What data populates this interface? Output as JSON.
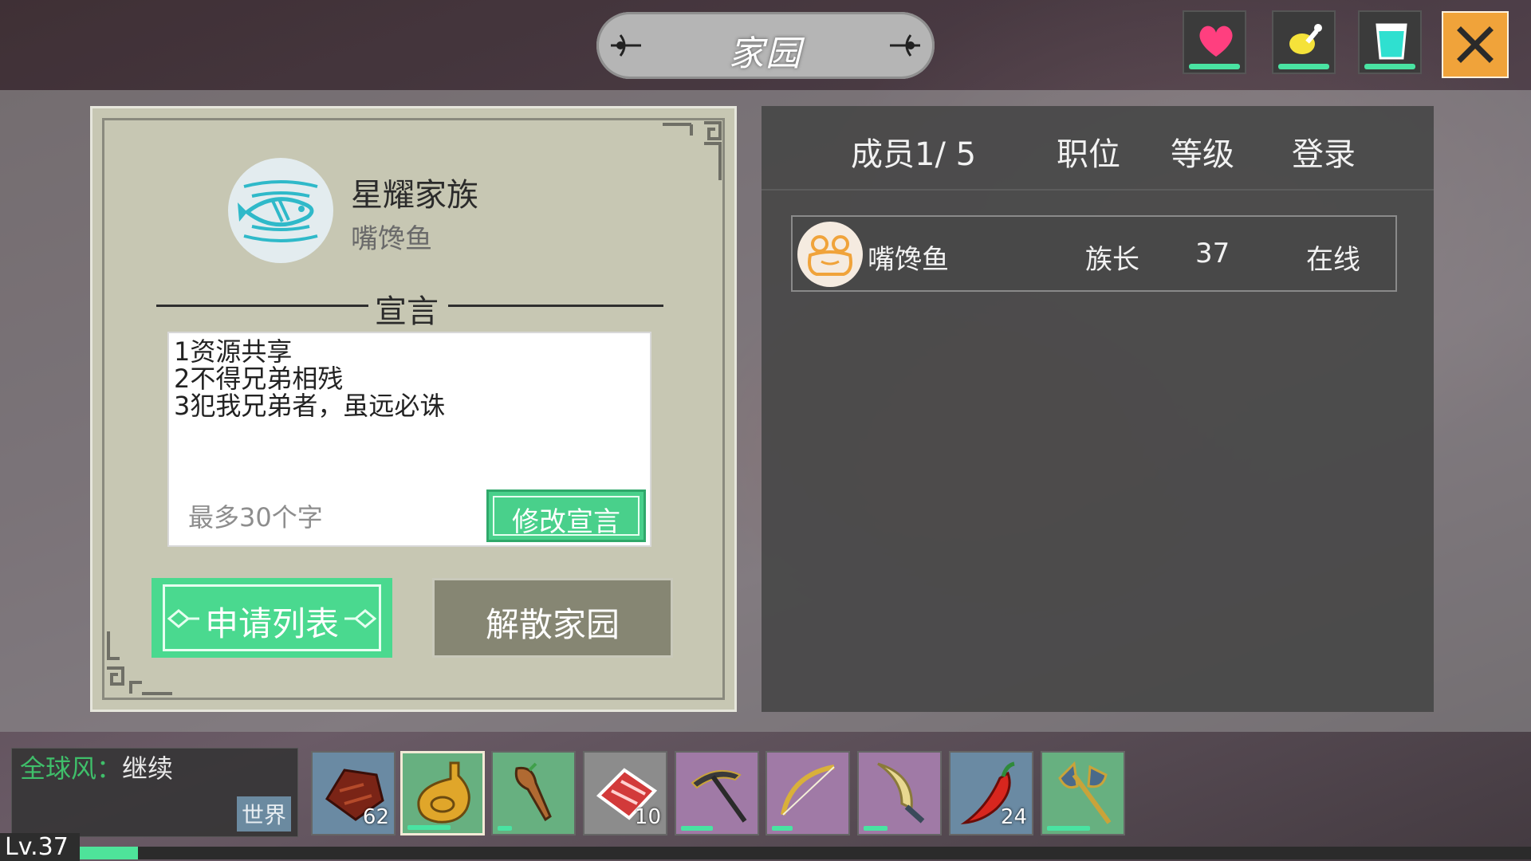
{
  "header": {
    "title": "家园",
    "status_icons": [
      {
        "name": "health",
        "icon": "heart-icon",
        "color": "#ff3f7f"
      },
      {
        "name": "food",
        "icon": "drumstick-icon",
        "color": "#f5e23a"
      },
      {
        "name": "water",
        "icon": "water-cup-icon",
        "color": "#2fe0d0"
      }
    ],
    "close_icon": "close-icon"
  },
  "clan": {
    "name": "星耀家族",
    "leader": "嘴馋鱼",
    "emblem_icon": "fish-icon",
    "declaration_title": "宣言",
    "declaration_lines": [
      "1资源共享",
      "2不得兄弟相残",
      "3犯我兄弟者，虽远必诛"
    ],
    "declaration_hint": "最多30个字",
    "edit_button": "修改宣言",
    "apply_list_button": "申请列表",
    "dissolve_button": "解散家园"
  },
  "members": {
    "headers": {
      "members": "成员1/ 5",
      "position": "职位",
      "level": "等级",
      "login": "登录"
    },
    "rows": [
      {
        "name": "嘴馋鱼",
        "avatar_icon": "frog-avatar-icon",
        "position": "族长",
        "level": "37",
        "login": "在线"
      }
    ]
  },
  "chat": {
    "channel": "全球风：",
    "message": "继续",
    "tag": "世界"
  },
  "hotbar": [
    {
      "icon": "meat-chunk-icon",
      "count": "62",
      "bg": "blue"
    },
    {
      "icon": "water-flask-icon",
      "count": "",
      "bg": "green",
      "selected": true,
      "durability": 0.55
    },
    {
      "icon": "club-icon",
      "count": "",
      "bg": "green",
      "durability": 0.2
    },
    {
      "icon": "raw-steak-icon",
      "count": "10",
      "bg": "gray"
    },
    {
      "icon": "pickaxe-icon",
      "count": "",
      "bg": "purple",
      "durability": 0.45
    },
    {
      "icon": "bow-icon",
      "count": "",
      "bg": "purple",
      "durability": 0.3
    },
    {
      "icon": "claw-blade-icon",
      "count": "",
      "bg": "purple",
      "durability": 0.35
    },
    {
      "icon": "chili-pepper-icon",
      "count": "24",
      "bg": "blue"
    },
    {
      "icon": "battle-axe-icon",
      "count": "",
      "bg": "green",
      "durability": 0.55
    }
  ],
  "player": {
    "level": "Lv.37",
    "xp_fraction": 0.04,
    "accent_color": "#4ee39a"
  }
}
